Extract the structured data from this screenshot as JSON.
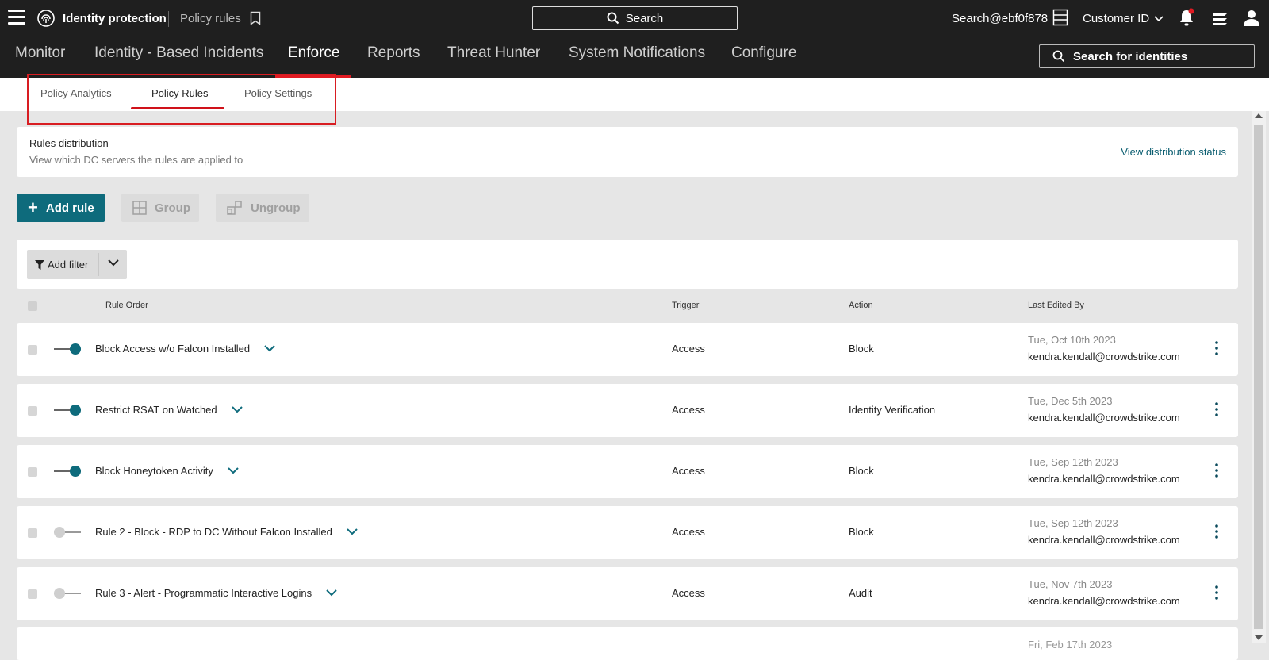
{
  "topbar": {
    "app_title": "Identity protection",
    "breadcrumb": "Policy rules",
    "search_label": "Search",
    "user": "Search@ebf0f878",
    "customer": "Customer ID"
  },
  "nav": {
    "items": [
      "Monitor",
      "Identity - Based Incidents",
      "Enforce",
      "Reports",
      "Threat Hunter",
      "System Notifications",
      "Configure"
    ],
    "active": "Enforce",
    "identity_search": "Search for identities"
  },
  "subtabs": {
    "items": [
      "Policy Analytics",
      "Policy Rules",
      "Policy Settings"
    ],
    "active": "Policy Rules"
  },
  "distribution": {
    "title": "Rules distribution",
    "subtitle": "View which DC servers the rules are applied to",
    "link": "View distribution status"
  },
  "actions": {
    "add_rule": "Add rule",
    "group": "Group",
    "ungroup": "Ungroup",
    "add_filter": "Add filter"
  },
  "table": {
    "headers": {
      "rule_order": "Rule Order",
      "trigger": "Trigger",
      "action": "Action",
      "last_edited_by": "Last Edited By"
    },
    "rows": [
      {
        "enabled": true,
        "name": "Block Access w/o Falcon Installed",
        "trigger": "Access",
        "action": "Block",
        "date": "Tue, Oct 10th 2023",
        "editor": "kendra.kendall@crowdstrike.com"
      },
      {
        "enabled": true,
        "name": "Restrict RSAT on Watched",
        "trigger": "Access",
        "action": "Identity Verification",
        "date": "Tue, Dec 5th 2023",
        "editor": "kendra.kendall@crowdstrike.com"
      },
      {
        "enabled": true,
        "name": "Block Honeytoken Activity",
        "trigger": "Access",
        "action": "Block",
        "date": "Tue, Sep 12th 2023",
        "editor": "kendra.kendall@crowdstrike.com"
      },
      {
        "enabled": false,
        "name": "Rule 2 - Block - RDP to DC Without Falcon Installed",
        "trigger": "Access",
        "action": "Block",
        "date": "Tue, Sep 12th 2023",
        "editor": "kendra.kendall@crowdstrike.com"
      },
      {
        "enabled": false,
        "name": "Rule 3 - Alert - Programmatic Interactive Logins",
        "trigger": "Access",
        "action": "Audit",
        "date": "Tue, Nov 7th 2023",
        "editor": "kendra.kendall@crowdstrike.com"
      }
    ],
    "partial_row_date": "Fri, Feb 17th 2023"
  },
  "colors": {
    "accent": "#0e6b7c",
    "highlight": "#d81d22",
    "topbar_bg": "#1f1f1f"
  }
}
